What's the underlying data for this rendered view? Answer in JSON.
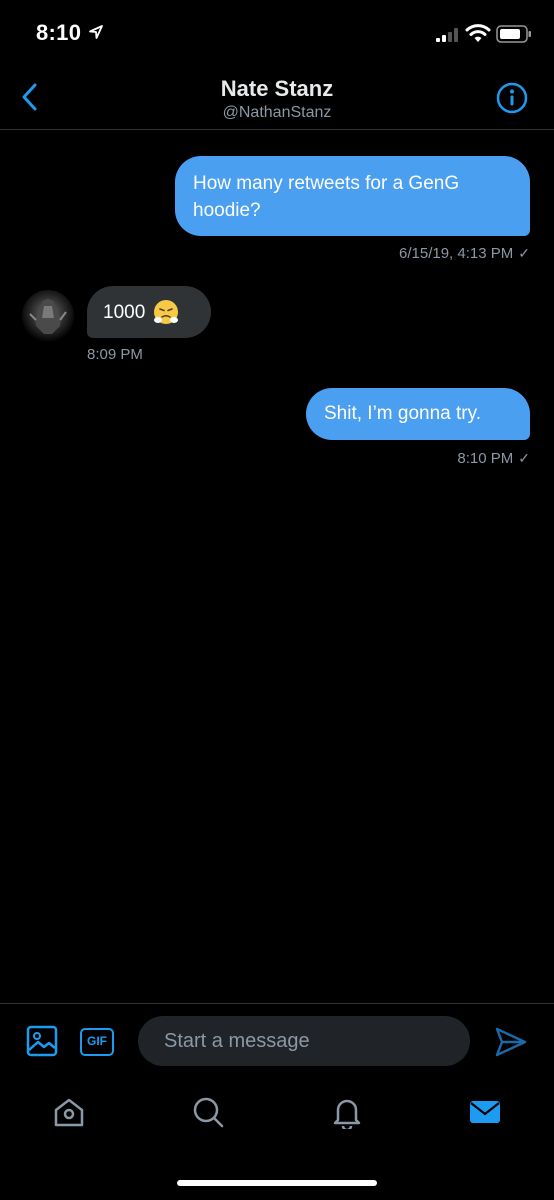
{
  "status_bar": {
    "time": "8:10"
  },
  "header": {
    "title": "Nate Stanz",
    "handle": "@NathanStanz"
  },
  "messages": [
    {
      "direction": "sent",
      "text": "How many retweets for a GenG hoodie?",
      "timestamp": "6/15/19, 4:13 PM",
      "status": "✓"
    },
    {
      "direction": "received",
      "text": "1000",
      "emoji": "face-with-steam-from-nose",
      "timestamp": "8:09 PM"
    },
    {
      "direction": "sent",
      "text": "Shit, I’m gonna try.",
      "timestamp": "8:10 PM",
      "status": "✓"
    }
  ],
  "composer": {
    "placeholder": "Start a message",
    "gif_label": "GIF"
  },
  "tabbar": {
    "items": [
      "home-icon",
      "search-icon",
      "notifications-icon",
      "messages-icon"
    ],
    "active": "messages-icon"
  },
  "colors": {
    "accent": "#1d9bf0",
    "sent_bubble": "#4a9ff0",
    "received_bubble": "#2f3336",
    "muted_text": "#8b98a5"
  }
}
